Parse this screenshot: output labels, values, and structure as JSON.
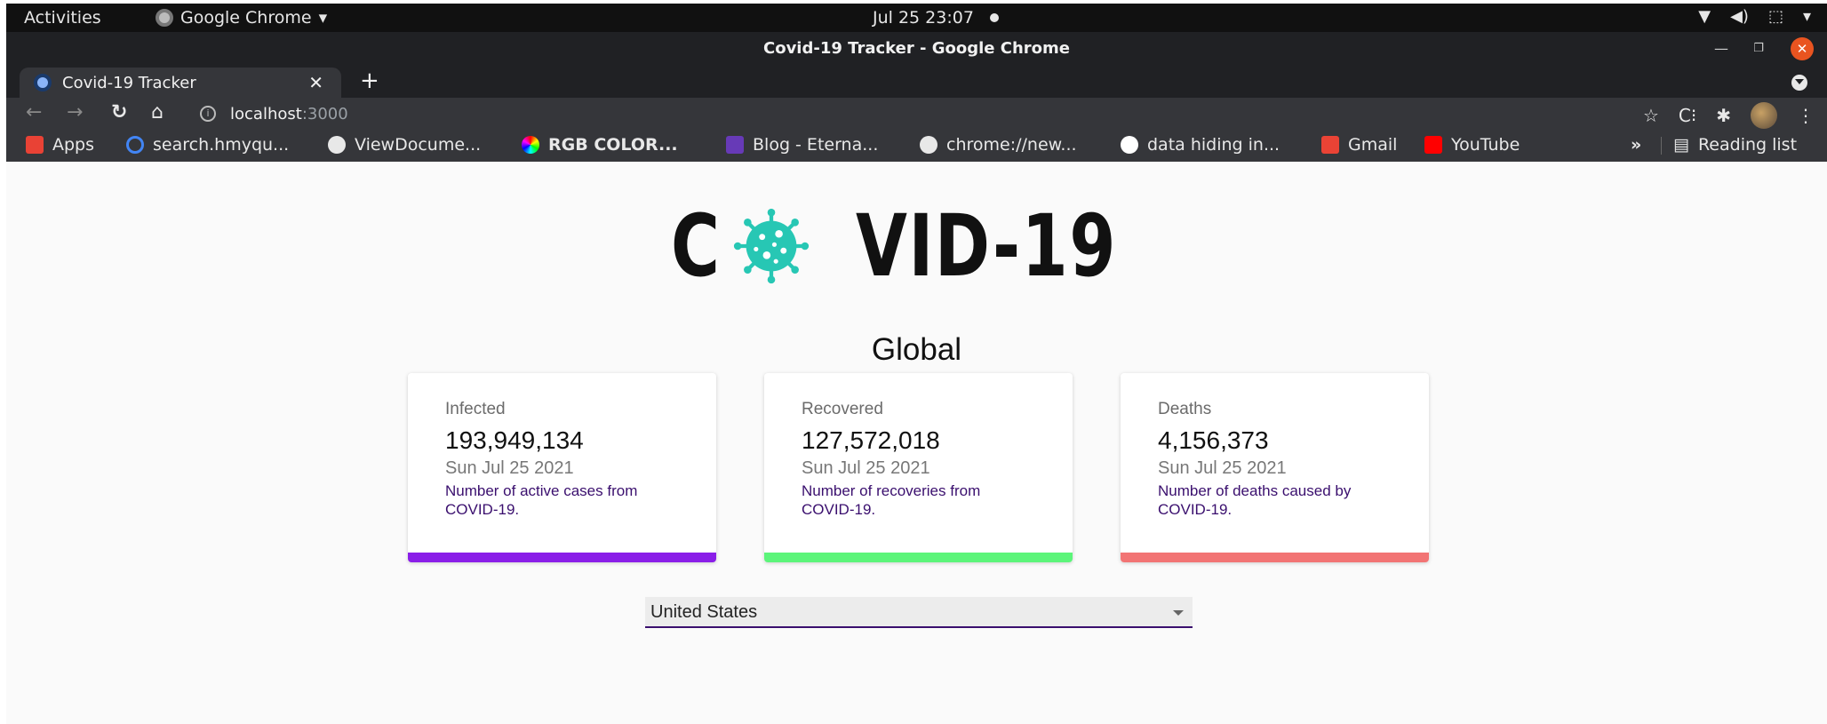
{
  "system_bar": {
    "activities": "Activities",
    "app_name": "Google Chrome",
    "datetime": "Jul 25  23:07"
  },
  "window": {
    "title": "Covid-19 Tracker - Google Chrome"
  },
  "tab": {
    "title": "Covid-19 Tracker"
  },
  "address_bar": {
    "host": "localhost",
    "port": ":3000"
  },
  "bookmarks": [
    {
      "label": "Apps",
      "icon": "apps-grid-icon",
      "color": "#e94235"
    },
    {
      "label": "search.hmyqu...",
      "icon": "spinner-icon",
      "color": "#4285f4"
    },
    {
      "label": "ViewDocume...",
      "icon": "globe-icon",
      "color": "#e8e8e8"
    },
    {
      "label": "RGB COLOR...",
      "icon": "color-wheel-icon",
      "color": "#ff00aa"
    },
    {
      "label": "Blog - Eterna...",
      "icon": "blogger-icon",
      "color": "#673ab7"
    },
    {
      "label": "chrome://new...",
      "icon": "globe-icon",
      "color": "#e8e8e8"
    },
    {
      "label": "data hiding in...",
      "icon": "google-icon",
      "color": "#ffffff"
    },
    {
      "label": "Gmail",
      "icon": "gmail-icon",
      "color": "#ea4335"
    },
    {
      "label": "YouTube",
      "icon": "youtube-icon",
      "color": "#ff0000"
    }
  ],
  "bookmarks_more": "»",
  "reading_list": "Reading list",
  "page": {
    "logo_text_left": "C",
    "logo_text_right": "VID-19",
    "heading": "Global",
    "cards": [
      {
        "label": "Infected",
        "count": "193,949,134",
        "date": "Sun Jul 25 2021",
        "description": "Number of active cases from COVID-19.",
        "color": "#8a1ee8"
      },
      {
        "label": "Recovered",
        "count": "127,572,018",
        "date": "Sun Jul 25 2021",
        "description": "Number of recoveries from COVID-19.",
        "color": "#5cf57a"
      },
      {
        "label": "Deaths",
        "count": "4,156,373",
        "date": "Sun Jul 25 2021",
        "description": "Number of deaths caused by COVID-19.",
        "color": "#f27474"
      }
    ],
    "country_select": {
      "value": "United States"
    }
  }
}
